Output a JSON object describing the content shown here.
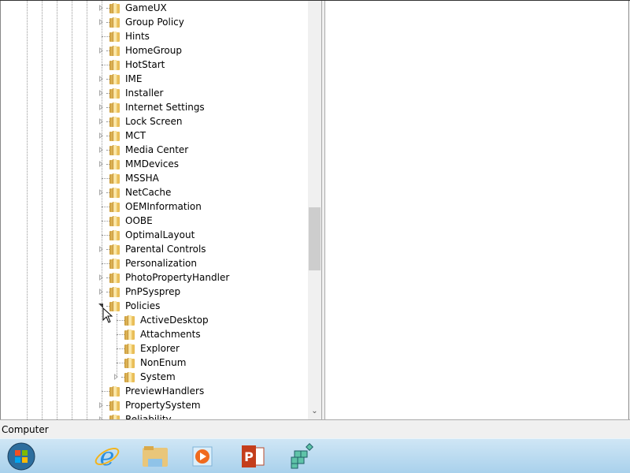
{
  "tree": {
    "items": [
      {
        "label": "GameUX",
        "expander": "collapsed",
        "level": 0
      },
      {
        "label": "Group Policy",
        "expander": "collapsed",
        "level": 0
      },
      {
        "label": "Hints",
        "expander": "none",
        "level": 0
      },
      {
        "label": "HomeGroup",
        "expander": "collapsed",
        "level": 0
      },
      {
        "label": "HotStart",
        "expander": "none",
        "level": 0
      },
      {
        "label": "IME",
        "expander": "collapsed",
        "level": 0
      },
      {
        "label": "Installer",
        "expander": "collapsed",
        "level": 0
      },
      {
        "label": "Internet Settings",
        "expander": "collapsed",
        "level": 0
      },
      {
        "label": "Lock Screen",
        "expander": "collapsed",
        "level": 0
      },
      {
        "label": "MCT",
        "expander": "collapsed",
        "level": 0
      },
      {
        "label": "Media Center",
        "expander": "collapsed",
        "level": 0
      },
      {
        "label": "MMDevices",
        "expander": "collapsed",
        "level": 0
      },
      {
        "label": "MSSHA",
        "expander": "none",
        "level": 0
      },
      {
        "label": "NetCache",
        "expander": "collapsed",
        "level": 0
      },
      {
        "label": "OEMInformation",
        "expander": "none",
        "level": 0
      },
      {
        "label": "OOBE",
        "expander": "none",
        "level": 0
      },
      {
        "label": "OptimalLayout",
        "expander": "none",
        "level": 0
      },
      {
        "label": "Parental Controls",
        "expander": "collapsed",
        "level": 0
      },
      {
        "label": "Personalization",
        "expander": "none",
        "level": 0
      },
      {
        "label": "PhotoPropertyHandler",
        "expander": "collapsed",
        "level": 0
      },
      {
        "label": "PnPSysprep",
        "expander": "collapsed",
        "level": 0
      },
      {
        "label": "Policies",
        "expander": "expanded",
        "level": 0
      },
      {
        "label": "ActiveDesktop",
        "expander": "none",
        "level": 1
      },
      {
        "label": "Attachments",
        "expander": "none",
        "level": 1
      },
      {
        "label": "Explorer",
        "expander": "none",
        "level": 1
      },
      {
        "label": "NonEnum",
        "expander": "none",
        "level": 1
      },
      {
        "label": "System",
        "expander": "collapsed",
        "level": 1
      },
      {
        "label": "PreviewHandlers",
        "expander": "none",
        "level": 0
      },
      {
        "label": "PropertySystem",
        "expander": "collapsed",
        "level": 0
      },
      {
        "label": "Reliability",
        "expander": "collapsed",
        "level": 0
      }
    ]
  },
  "status": {
    "text": "Computer"
  },
  "taskbar": {
    "items": [
      {
        "name": "start-button",
        "icon": "windows-orb-icon"
      },
      {
        "name": "internet-explorer",
        "icon": "internet-explorer-icon"
      },
      {
        "name": "windows-explorer",
        "icon": "folder-explorer-icon"
      },
      {
        "name": "media-player",
        "icon": "media-player-icon"
      },
      {
        "name": "powerpoint",
        "icon": "powerpoint-icon"
      },
      {
        "name": "registry-editor",
        "icon": "regedit-icon"
      }
    ]
  }
}
